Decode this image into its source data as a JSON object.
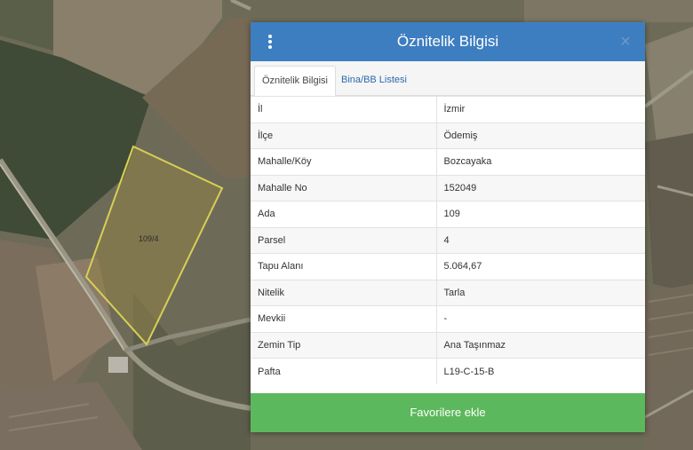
{
  "map": {
    "parcel_label": "109/4",
    "colors": {
      "base": "#6b6a55",
      "parcel_stroke": "#d8cf55",
      "parcel_fill": "#8f8148"
    }
  },
  "panel": {
    "title": "Öznitelik Bilgisi",
    "menu_icon": "vertical-dots-icon",
    "close_icon": "close-icon",
    "close_symbol": "×",
    "header_color": "#3d7ec0",
    "tabs": [
      {
        "label": "Öznitelik Bilgisi",
        "active": true
      },
      {
        "label": "Bina/BB Listesi",
        "active": false
      }
    ],
    "rows": [
      {
        "key": "İl",
        "value": "İzmir"
      },
      {
        "key": "İlçe",
        "value": "Ödemiş"
      },
      {
        "key": "Mahalle/Köy",
        "value": "Bozcayaka"
      },
      {
        "key": "Mahalle No",
        "value": "152049"
      },
      {
        "key": "Ada",
        "value": "109"
      },
      {
        "key": "Parsel",
        "value": "4"
      },
      {
        "key": "Tapu Alanı",
        "value": "5.064,67"
      },
      {
        "key": "Nitelik",
        "value": "Tarla"
      },
      {
        "key": "Mevkii",
        "value": "-"
      },
      {
        "key": "Zemin Tip",
        "value": "Ana Taşınmaz"
      },
      {
        "key": "Pafta",
        "value": "L19-C-15-B"
      }
    ],
    "favorite_button": {
      "label": "Favorilere ekle",
      "color": "#5cb85c"
    }
  }
}
